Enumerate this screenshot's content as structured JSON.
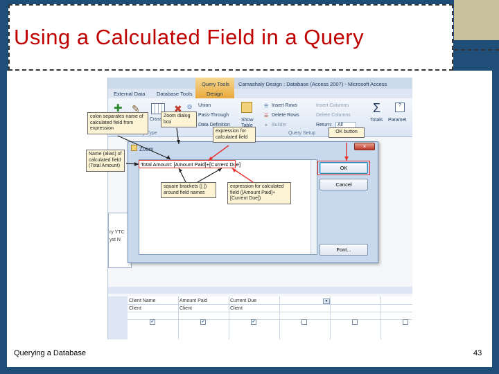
{
  "slide": {
    "title": "Using a Calculated Field in a Query",
    "footer_left": "Querying a Database",
    "page_number": "43"
  },
  "window": {
    "contextual_tab": "Query Tools",
    "title": "Camashaly Design : Database (Access 2007) - Microsoft Access",
    "tabs": [
      "External Data",
      "Database Tools",
      "Design"
    ]
  },
  "ribbon": {
    "union": "Union",
    "pass_through": "Pass-Through",
    "data_definition": "Data Definition",
    "crosstab": "Cross",
    "show_table": "Show\nTable",
    "insert_rows": "Insert Rows",
    "delete_rows": "Delete Rows",
    "builder": "Builder",
    "insert_columns": "Insert Columns",
    "delete_columns": "Delete Columns",
    "return_label": "Return:",
    "return_value": "All",
    "totals": "Totals",
    "parameters": "Paramet",
    "group_query_type": "uery Type",
    "group_query_setup": "Query Setup"
  },
  "side_stub": [
    "ry YTC",
    "yst N"
  ],
  "zoom_dialog": {
    "title": "Zoom",
    "expression": "Total Amount: [Amount Paid]+[Current Due]",
    "ok": "OK",
    "cancel": "Cancel",
    "font": "Font...",
    "close": "×"
  },
  "grid": {
    "columns": [
      {
        "field": "Client Name",
        "table": "Client",
        "show": true
      },
      {
        "field": "Amount Paid",
        "table": "Client",
        "show": true
      },
      {
        "field": "Current Due",
        "table": "Client",
        "show": true
      },
      {
        "field": "",
        "table": "",
        "show": false
      },
      {
        "field": "",
        "table": "",
        "show": false
      },
      {
        "field": "",
        "table": "",
        "show": false
      }
    ]
  },
  "callouts": {
    "colon": "colon separates name of calculated field from expression",
    "zoom_box": "Zoom dialog box",
    "expression_for": "expression for calculated field",
    "ok_button": "OK button",
    "alias": "Name (alias) of calculated field (Total Amount)",
    "brackets": "square brackets ([ ]) around field names",
    "expression_detail": "expression for calculated field ([Amount Paid]+[Current Due])"
  },
  "colors": {
    "frame": "#1f4e79",
    "title": "#c00000",
    "callout": "#fdf4d6",
    "highlight": "#e53030"
  }
}
